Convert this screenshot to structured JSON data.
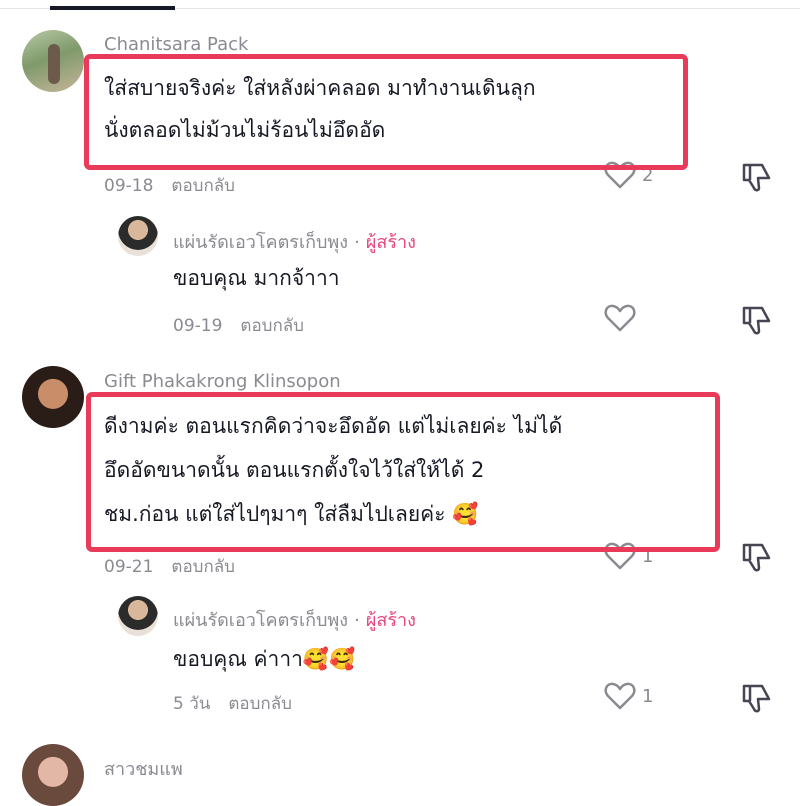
{
  "comments": [
    {
      "username": "Chanitsara Pack",
      "lines": [
        "ใส่สบายจริงค่ะ ใส่หลังผ่าคลอด มาทำงานเดินลุก",
        "นั่งตลอดไม่ม้วนไม่ร้อนไม่อึดอัด"
      ],
      "date": "09-18",
      "reply_label": "ตอบกลับ",
      "like_count": "2",
      "reply": {
        "username": "แผ่นรัดเอวโคตรเก็บพุง",
        "separator": "·",
        "creator_badge": "ผู้สร้าง",
        "text": "ขอบคุณ มากจ้าาา",
        "date": "09-19",
        "reply_label": "ตอบกลับ",
        "like_count": ""
      }
    },
    {
      "username": "Gift Phakakrong Klinsopon",
      "lines": [
        "ดีงามค่ะ ตอนแรกคิดว่าจะอึดอัด แต่ไม่เลยค่ะ ไม่ได้",
        "อึดอัดขนาดนั้น ตอนแรกตั้งใจไว้ใส่ให้ได้ 2",
        "ชม.ก่อน แต่ใส่ไปๆมาๆ ใส่ลืมไปเลยค่ะ 🥰"
      ],
      "date": "09-21",
      "reply_label": "ตอบกลับ",
      "like_count": "1",
      "reply": {
        "username": "แผ่นรัดเอวโคตรเก็บพุง",
        "separator": "·",
        "creator_badge": "ผู้สร้าง",
        "text": "ขอบคุณ ค่าาา🥰🥰",
        "date": "5 วัน",
        "reply_label": "ตอบกลับ",
        "like_count": "1"
      }
    },
    {
      "username": "สาวชมแพ"
    }
  ],
  "icons": {
    "like": "heart-icon",
    "dislike": "thumbs-down-icon"
  },
  "colors": {
    "highlight": "#ea3a5a",
    "creator": "#e8447e",
    "meta": "#8a8b91"
  }
}
